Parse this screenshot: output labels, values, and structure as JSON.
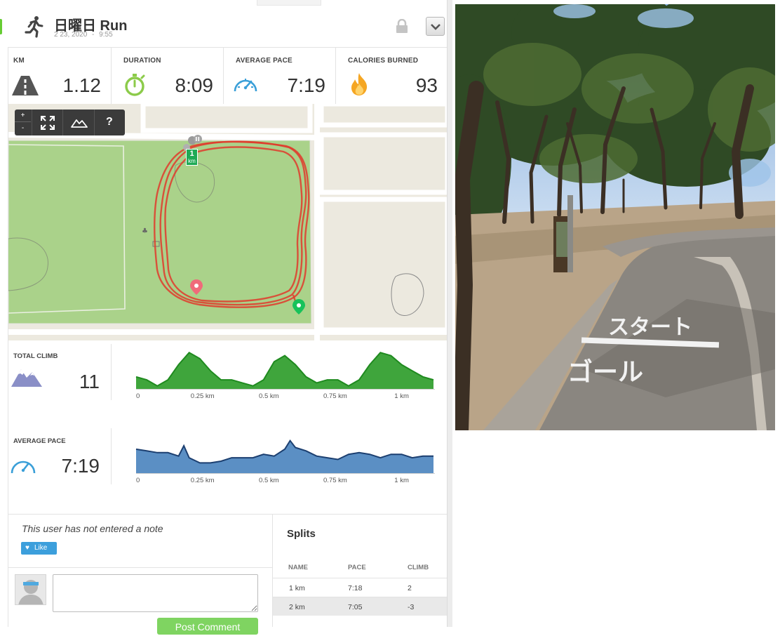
{
  "header": {
    "title": "日曜日 Run",
    "date": "2 23, 2020",
    "separator": "-",
    "time": "9:55",
    "icons": {
      "activity": "runner-icon",
      "privacy": "lock-icon",
      "menu": "chevron-down-icon"
    }
  },
  "stats": [
    {
      "label": "KM",
      "value": "1.12",
      "icon": "road-icon"
    },
    {
      "label": "DURATION",
      "value": "8:09",
      "icon": "stopwatch-icon"
    },
    {
      "label": "AVERAGE PACE",
      "value": "7:19",
      "icon": "speedometer-icon"
    },
    {
      "label": "CALORIES BURNED",
      "value": "93",
      "icon": "flame-icon"
    }
  ],
  "map": {
    "controls": {
      "zoom_in": "+",
      "zoom_out": "-",
      "help": "?"
    },
    "marker_label": "1",
    "marker_unit": "km"
  },
  "climb": {
    "label": "TOTAL CLIMB",
    "value": "11",
    "color": "#3fa53c",
    "x_ticks": [
      "0",
      "0.25 km",
      "0.5 km",
      "0.75 km",
      "1 km"
    ]
  },
  "pace": {
    "label": "AVERAGE PACE",
    "value": "7:19",
    "color": "#5b8fc4",
    "x_ticks": [
      "0",
      "0.25 km",
      "0.5 km",
      "0.75 km",
      "1 km"
    ]
  },
  "chart_data": [
    {
      "type": "area",
      "xlabel": "",
      "ylabel": "",
      "x_ticks": [
        "0",
        "0.25 km",
        "0.5 km",
        "0.75 km",
        "1 km"
      ],
      "xlim": [
        0,
        1.12
      ],
      "x": [
        0,
        0.04,
        0.08,
        0.12,
        0.16,
        0.2,
        0.24,
        0.28,
        0.32,
        0.36,
        0.4,
        0.44,
        0.48,
        0.52,
        0.56,
        0.6,
        0.64,
        0.68,
        0.72,
        0.76,
        0.8,
        0.84,
        0.88,
        0.92,
        0.96,
        1.0,
        1.04,
        1.08,
        1.12
      ],
      "values": [
        4,
        3,
        1,
        3,
        8,
        12,
        10,
        6,
        3,
        3,
        2,
        1,
        3,
        9,
        11,
        8,
        4,
        2,
        3,
        3,
        1,
        3,
        8,
        12,
        11,
        8,
        6,
        4,
        3
      ]
    },
    {
      "type": "area",
      "xlabel": "",
      "ylabel": "",
      "x_ticks": [
        "0",
        "0.25 km",
        "0.5 km",
        "0.75 km",
        "1 km"
      ],
      "xlim": [
        0,
        1.12
      ],
      "x": [
        0,
        0.04,
        0.08,
        0.12,
        0.16,
        0.18,
        0.2,
        0.24,
        0.28,
        0.32,
        0.36,
        0.4,
        0.44,
        0.48,
        0.52,
        0.56,
        0.58,
        0.6,
        0.64,
        0.68,
        0.72,
        0.76,
        0.8,
        0.84,
        0.88,
        0.92,
        0.96,
        1.0,
        1.04,
        1.08,
        1.12
      ],
      "values": [
        7.0,
        6.9,
        6.8,
        6.8,
        6.6,
        7.2,
        6.5,
        6.2,
        6.2,
        6.3,
        6.5,
        6.5,
        6.5,
        6.7,
        6.6,
        7.0,
        7.5,
        7.1,
        6.9,
        6.6,
        6.5,
        6.4,
        6.7,
        6.8,
        6.7,
        6.5,
        6.7,
        6.7,
        6.5,
        6.6,
        6.6
      ]
    }
  ],
  "note": {
    "text": "This user has not entered a note",
    "like_label": "Like"
  },
  "comment": {
    "post_label": "Post Comment"
  },
  "splits": {
    "title": "Splits",
    "headers": [
      "NAME",
      "PACE",
      "CLIMB"
    ],
    "rows": [
      {
        "name": "1 km",
        "pace": "7:18",
        "climb": "2"
      },
      {
        "name": "2 km",
        "pace": "7:05",
        "climb": "-3"
      }
    ]
  },
  "photo": {
    "sign_text_1": "スタート",
    "sign_text_2": "ゴール"
  }
}
